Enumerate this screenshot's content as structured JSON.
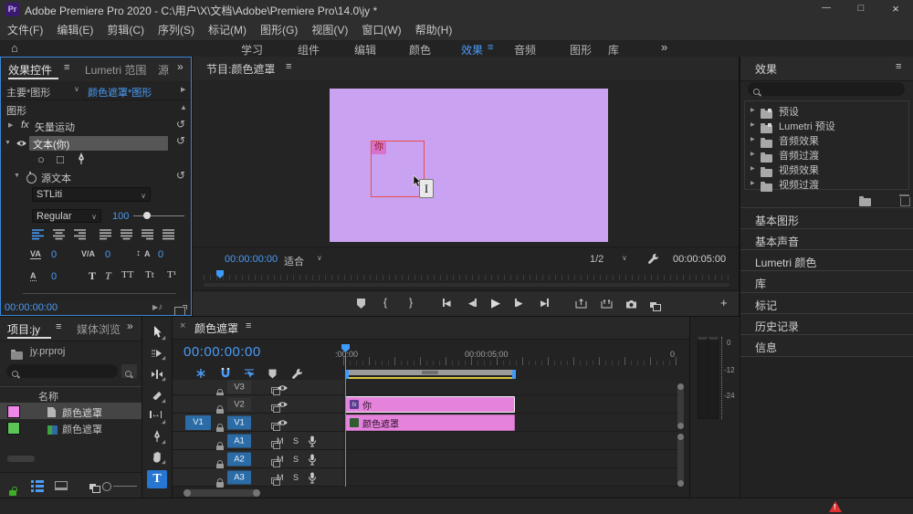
{
  "icons": {
    "panel_menu": "≡",
    "overflow": "»",
    "home": "⌂",
    "chevron_down": "∨",
    "chevron_right": "▶",
    "chevron_left_small": "◀",
    "collapse_up": "▲",
    "expand_down": "▼",
    "reset": "↺",
    "ellipse": "○",
    "rectangle": "□",
    "close": "×",
    "minimize": "—",
    "maximize": "□",
    "play": "▶",
    "note": "♪",
    "plus": "+",
    "mark_in": "{",
    "mark_out": "}",
    "slip": "↔",
    "leading": "↕"
  },
  "title_bar": {
    "app_icon": "Pr",
    "title": "Adobe Premiere Pro 2020 - C:\\用户\\X\\文档\\Adobe\\Premiere Pro\\14.0\\jy *"
  },
  "menu_bar": {
    "items": [
      "文件(F)",
      "编辑(E)",
      "剪辑(C)",
      "序列(S)",
      "标记(M)",
      "图形(G)",
      "视图(V)",
      "窗口(W)",
      "帮助(H)"
    ]
  },
  "workspace": {
    "tabs": [
      "学习",
      "组件",
      "编辑",
      "颜色",
      "效果",
      "音频",
      "图形",
      "库"
    ],
    "active_tab": "效果"
  },
  "effect_controls": {
    "tab_effect_controls": "效果控件",
    "tab_lumetri_scopes": "Lumetri 范围",
    "tab_source": "源",
    "master_clip": "主要*图形",
    "sequence_clip": "颜色遮罩*图形",
    "section_graphics": "图形",
    "fx_badge": "fx",
    "vector_motion": "矢量运动",
    "text_layer": "文本(你)",
    "source_text": "源文本",
    "font_name": "STLiti",
    "font_style": "Regular",
    "font_size": "100",
    "kerning_icon": "VA",
    "tracking_icon": "V/A",
    "leading_value": "0",
    "kerning_value": "0",
    "tracking_value": "0",
    "baseline_value": "0",
    "t_bold": "T",
    "t_italic": "T",
    "t_caps": "TT",
    "t_small_caps": "Tt",
    "t_super": "T¹",
    "timecode": "00:00:00:00"
  },
  "program_monitor": {
    "title": "节目:颜色遮罩",
    "overlay_text": "你",
    "timecode": "00:00:00:00",
    "zoom_level": "适合",
    "playback_resolution": "1/2",
    "duration": "00:00:05:00"
  },
  "effects_panel": {
    "title": "效果",
    "folders": [
      "预设",
      "Lumetri 预设",
      "音频效果",
      "音频过渡",
      "视频效果",
      "视频过渡"
    ]
  },
  "panel_stack": {
    "items": [
      "基本图形",
      "基本声音",
      "Lumetri 颜色",
      "库",
      "标记",
      "历史记录",
      "信息"
    ]
  },
  "project_panel": {
    "tab_project": "项目:jy",
    "tab_media_browser": "媒体浏览",
    "project_file": "jy.prproj",
    "column_name": "名称",
    "rows": [
      {
        "name": "颜色遮罩",
        "swatch": "#ef87e7",
        "selected": true
      },
      {
        "name": "颜色遮罩",
        "swatch": "#5cc556",
        "selected": false
      }
    ]
  },
  "timeline": {
    "tab": "颜色遮罩",
    "timecode": "00:00:00:00",
    "ruler_labels": [
      ":00:00",
      "00:00:05:00",
      "0"
    ],
    "source_patch_v1": "V1",
    "tracks": {
      "v3": "V3",
      "v2": "V2",
      "v1": "V1",
      "a1": "A1",
      "a2": "A2",
      "a3": "A3"
    },
    "mute": "M",
    "solo": "S",
    "clip_v2": {
      "badge": "fx",
      "label": "你"
    },
    "clip_v1": {
      "label": "颜色遮罩"
    }
  },
  "audio_meter": {
    "ticks": [
      "0",
      "-12",
      "-24"
    ]
  }
}
